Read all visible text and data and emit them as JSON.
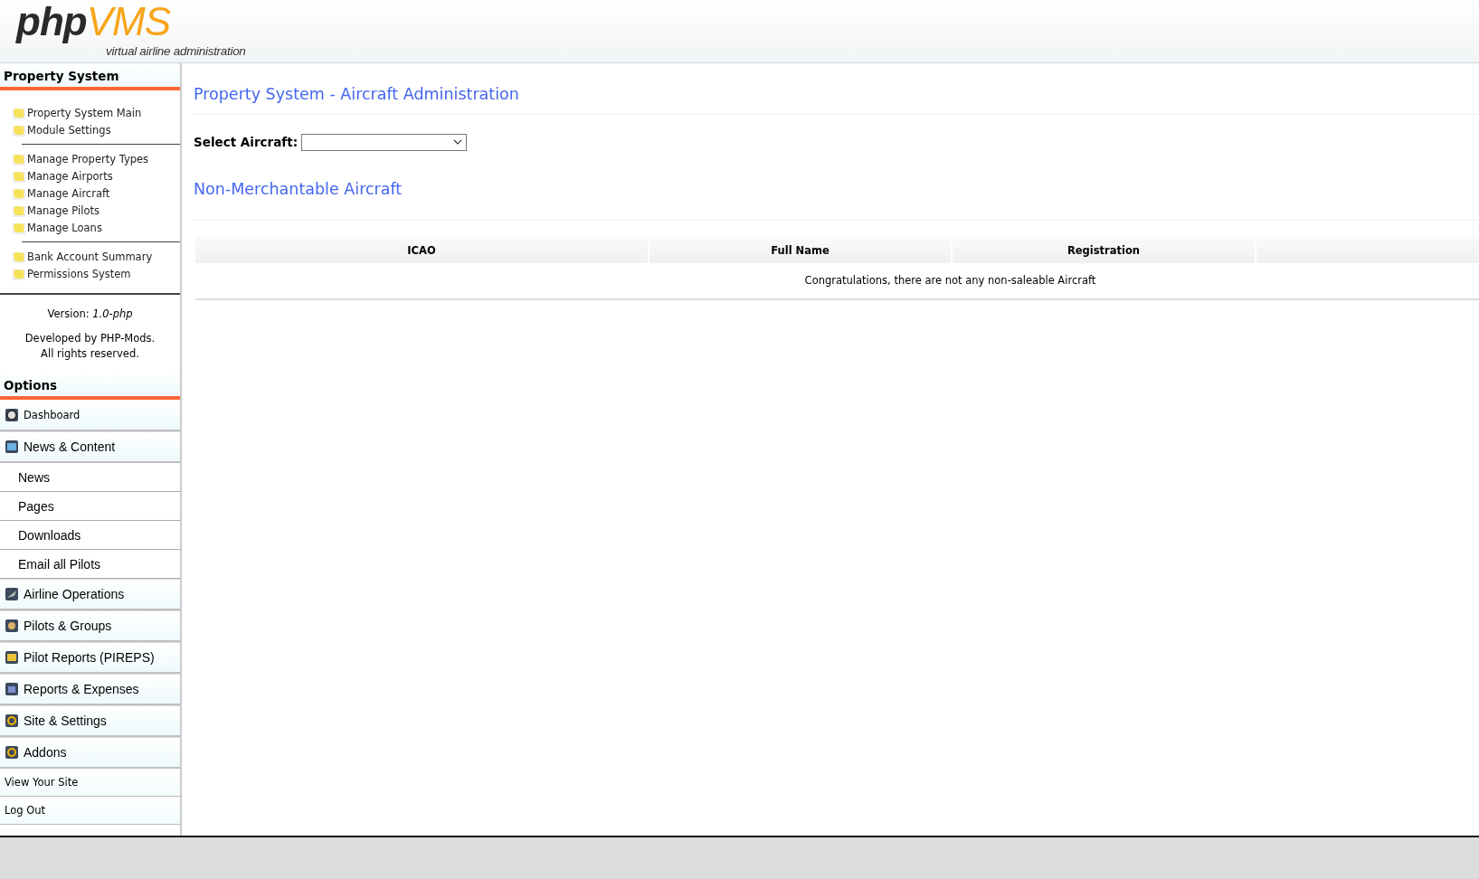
{
  "header": {
    "logo_part_1": "php",
    "logo_part_2": "VMS",
    "tagline": "virtual airline administration"
  },
  "sidebar": {
    "property_system": {
      "title": "Property System",
      "groups": [
        [
          "Property System Main",
          "Module Settings"
        ],
        [
          "Manage Property Types",
          "Manage Airports",
          "Manage Aircraft",
          "Manage Pilots",
          "Manage Loans"
        ],
        [
          "Bank Account Summary",
          "Permissions System"
        ]
      ],
      "version_label": "Version:",
      "version": "1.0-php",
      "credits": [
        "Developed by PHP-Mods.",
        "All rights reserved."
      ]
    },
    "options": {
      "title": "Options",
      "items": [
        {
          "kind": "section",
          "label": "Dashboard"
        },
        {
          "kind": "section",
          "label": "News & Content"
        },
        {
          "kind": "sub",
          "label": "News"
        },
        {
          "kind": "sub",
          "label": "Pages"
        },
        {
          "kind": "sub",
          "label": "Downloads"
        },
        {
          "kind": "sub",
          "label": "Email all Pilots"
        },
        {
          "kind": "section",
          "label": "Airline Operations"
        },
        {
          "kind": "section",
          "label": "Pilots & Groups"
        },
        {
          "kind": "section",
          "label": "Pilot Reports (PIREPS)"
        },
        {
          "kind": "section",
          "label": "Reports & Expenses"
        },
        {
          "kind": "section",
          "label": "Site & Settings"
        },
        {
          "kind": "section",
          "label": "Addons"
        },
        {
          "kind": "link",
          "label": "View Your Site"
        },
        {
          "kind": "link",
          "label": "Log Out"
        }
      ]
    }
  },
  "main": {
    "title": "Property System - Aircraft Administration",
    "select_label": "Select Aircraft:",
    "section_title": "Non-Merchantable Aircraft",
    "table": {
      "columns": [
        "ICAO",
        "Full Name",
        "Registration",
        ""
      ],
      "empty_message": "Congratulations, there are not any non-saleable Aircraft"
    }
  }
}
